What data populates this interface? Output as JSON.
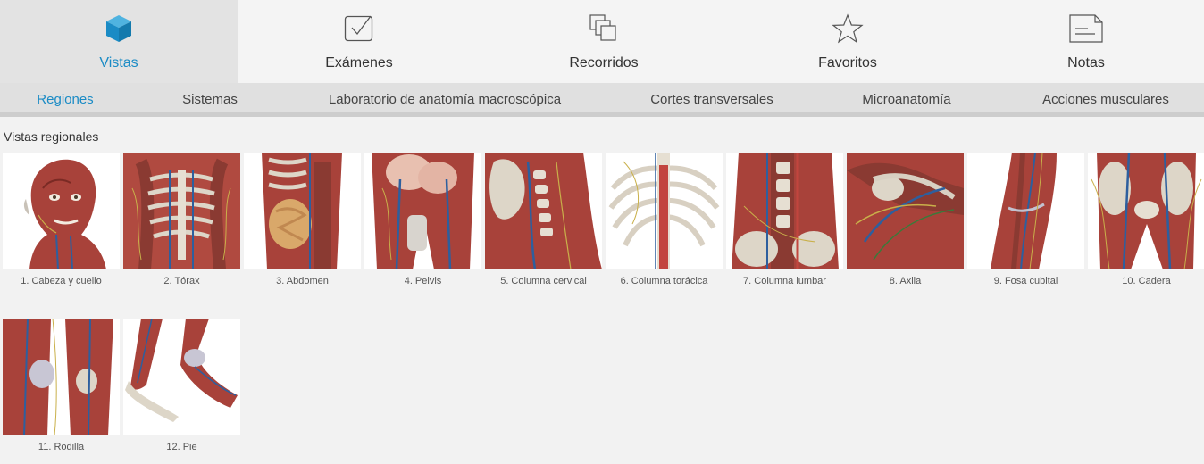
{
  "top_tabs": [
    {
      "label": "Vistas",
      "icon": "cube-icon",
      "active": true
    },
    {
      "label": "Exámenes",
      "icon": "checkbox-icon",
      "active": false
    },
    {
      "label": "Recorridos",
      "icon": "stacked-squares-icon",
      "active": false
    },
    {
      "label": "Favoritos",
      "icon": "star-icon",
      "active": false
    },
    {
      "label": "Notas",
      "icon": "note-icon",
      "active": false
    }
  ],
  "sub_tabs": [
    {
      "label": "Regiones",
      "active": true
    },
    {
      "label": "Sistemas",
      "active": false
    },
    {
      "label": "Laboratorio de anatomía macroscópica",
      "active": false
    },
    {
      "label": "Cortes transversales",
      "active": false
    },
    {
      "label": "Microanatomía",
      "active": false
    },
    {
      "label": "Acciones musculares",
      "active": false
    }
  ],
  "section_title": "Vistas regionales",
  "regions": [
    {
      "label": "1. Cabeza y cuello"
    },
    {
      "label": "2. Tórax"
    },
    {
      "label": "3. Abdomen"
    },
    {
      "label": "4. Pelvis"
    },
    {
      "label": "5. Columna cervical"
    },
    {
      "label": "6. Columna torácica"
    },
    {
      "label": "7. Columna lumbar"
    },
    {
      "label": "8. Axila"
    },
    {
      "label": "9. Fosa cubital"
    },
    {
      "label": "10. Cadera"
    },
    {
      "label": "11. Rodilla"
    },
    {
      "label": "12. Pie"
    }
  ],
  "colors": {
    "accent": "#1a8bc5",
    "muscle": "#a8423a",
    "bone": "#ddd6c8",
    "vein": "#2d5f9e",
    "nerve": "#c9b04a"
  }
}
